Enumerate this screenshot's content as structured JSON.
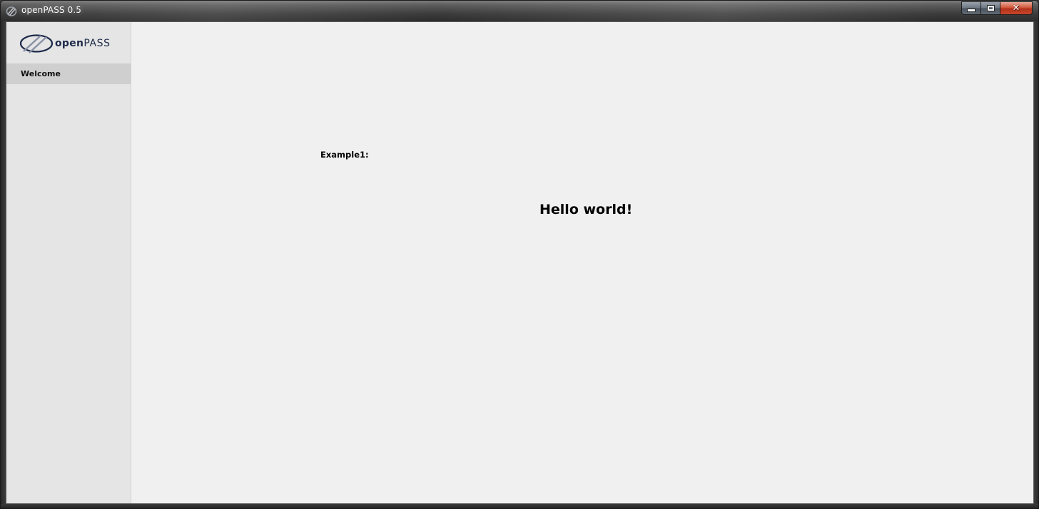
{
  "window": {
    "title": "openPASS 0.5",
    "icon": "openpass-app-icon"
  },
  "caption_buttons": {
    "minimize_icon": "minimize-icon",
    "maximize_icon": "maximize-icon",
    "close_icon": "close-icon"
  },
  "sidebar": {
    "logo": {
      "text_bold": "open",
      "text_regular": "PASS",
      "color": "#1e2a4a"
    },
    "items": [
      {
        "label": "Welcome",
        "selected": true
      }
    ]
  },
  "main": {
    "example_label": "Example1:",
    "hello_text": "Hello world!"
  },
  "colors": {
    "client_background": "#f0f0f0",
    "sidebar_background": "#e5e5e5",
    "selected_item_background": "#cfcfcf",
    "close_button": "#c8472c"
  }
}
